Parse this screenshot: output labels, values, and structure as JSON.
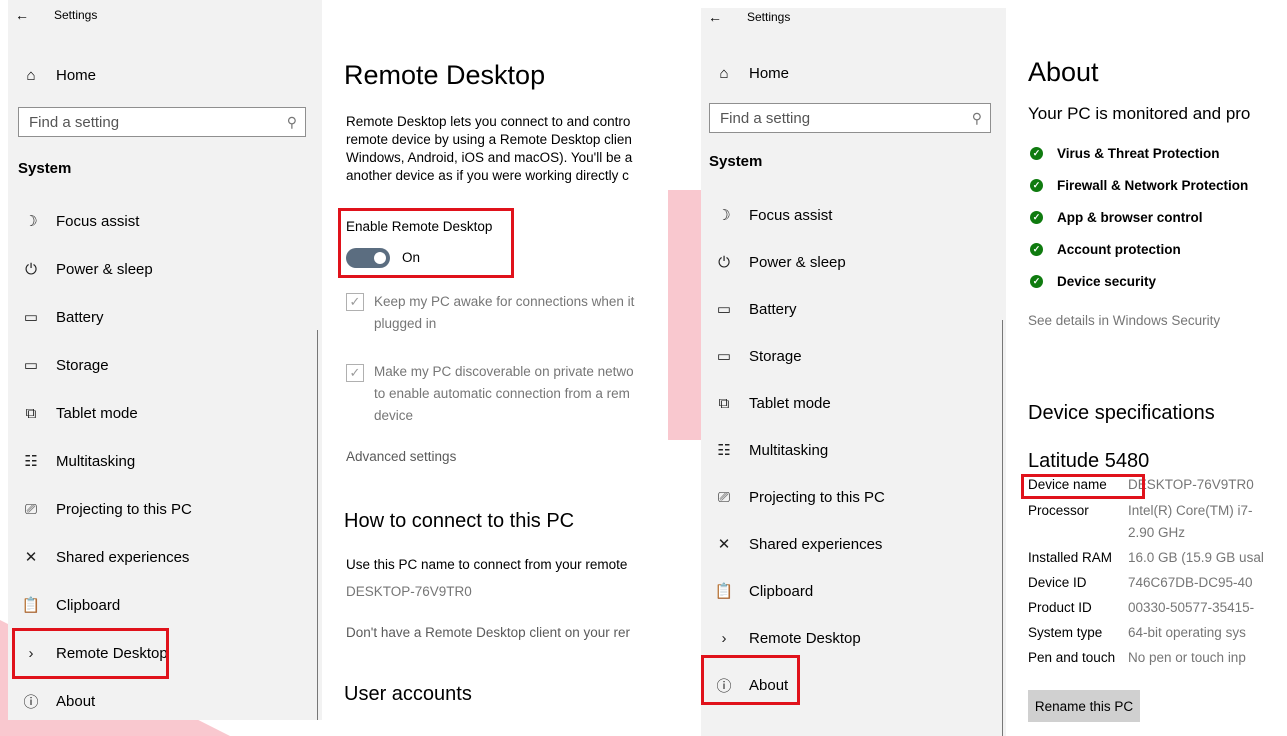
{
  "left_window": {
    "top_title": "Settings",
    "home": "Home",
    "search_placeholder": "Find a setting",
    "section": "System",
    "nav": [
      {
        "label": "Focus assist",
        "icon": "moon-icon"
      },
      {
        "label": "Power & sleep",
        "icon": "power-icon"
      },
      {
        "label": "Battery",
        "icon": "battery-icon"
      },
      {
        "label": "Storage",
        "icon": "storage-icon"
      },
      {
        "label": "Tablet mode",
        "icon": "tablet-icon"
      },
      {
        "label": "Multitasking",
        "icon": "multitasking-icon"
      },
      {
        "label": "Projecting to this PC",
        "icon": "projecting-icon"
      },
      {
        "label": "Shared experiences",
        "icon": "shared-icon"
      },
      {
        "label": "Clipboard",
        "icon": "clipboard-icon"
      },
      {
        "label": "Remote Desktop",
        "icon": "remote-desktop-icon"
      },
      {
        "label": "About",
        "icon": "info-icon"
      }
    ],
    "content": {
      "title": "Remote Desktop",
      "intro_lines": [
        "Remote Desktop lets you connect to and contro",
        "remote device by using a Remote Desktop clien",
        "Windows, Android, iOS and macOS). You'll be a",
        "another device as if you were working directly c"
      ],
      "enable_label": "Enable Remote Desktop",
      "toggle_state": "On",
      "keep_awake_lines": [
        "Keep my PC awake for connections when it",
        "plugged in"
      ],
      "discoverable_lines": [
        "Make my PC discoverable on private netwo",
        "to enable automatic connection from a rem",
        "device"
      ],
      "advanced": "Advanced settings",
      "how_title": "How to connect to this PC",
      "how_text": "Use this PC name to connect from your remote",
      "pc_name": "DESKTOP-76V9TR0",
      "client_link": "Don't have a Remote Desktop client on your rer",
      "accounts_title": "User accounts"
    }
  },
  "right_window": {
    "top_title": "Settings",
    "home": "Home",
    "search_placeholder": "Find a setting",
    "section": "System",
    "nav": [
      {
        "label": "Focus assist",
        "icon": "moon-icon"
      },
      {
        "label": "Power & sleep",
        "icon": "power-icon"
      },
      {
        "label": "Battery",
        "icon": "battery-icon"
      },
      {
        "label": "Storage",
        "icon": "storage-icon"
      },
      {
        "label": "Tablet mode",
        "icon": "tablet-icon"
      },
      {
        "label": "Multitasking",
        "icon": "multitasking-icon"
      },
      {
        "label": "Projecting to this PC",
        "icon": "projecting-icon"
      },
      {
        "label": "Shared experiences",
        "icon": "shared-icon"
      },
      {
        "label": "Clipboard",
        "icon": "clipboard-icon"
      },
      {
        "label": "Remote Desktop",
        "icon": "remote-desktop-icon"
      },
      {
        "label": "About",
        "icon": "info-icon"
      }
    ],
    "content": {
      "title": "About",
      "monitored": "Your PC is monitored and pro",
      "security_items": [
        "Virus & Threat Protection",
        "Firewall & Network Protection",
        "App & browser control",
        "Account protection",
        "Device security"
      ],
      "security_link": "See details in Windows Security",
      "specs_title": "Device specifications",
      "model": "Latitude 5480",
      "specs": [
        {
          "k": "Device name",
          "v": "DESKTOP-76V9TR0"
        },
        {
          "k": "Processor",
          "v": "Intel(R) Core(TM) i7-"
        },
        {
          "k": "",
          "v": "2.90 GHz"
        },
        {
          "k": "Installed RAM",
          "v": "16.0 GB (15.9 GB usal"
        },
        {
          "k": "Device ID",
          "v": "746C67DB-DC95-40"
        },
        {
          "k": "Product ID",
          "v": "00330-50577-35415-"
        },
        {
          "k": "System type",
          "v": "64-bit operating sys"
        },
        {
          "k": "Pen and touch",
          "v": "No pen or touch inp"
        }
      ],
      "rename_button": "Rename this PC"
    }
  },
  "colors": {
    "highlight": "#e0121b",
    "toggle": "#5b6d80",
    "ok": "#0f7b0f",
    "sidebar": "#f2f2f2"
  }
}
